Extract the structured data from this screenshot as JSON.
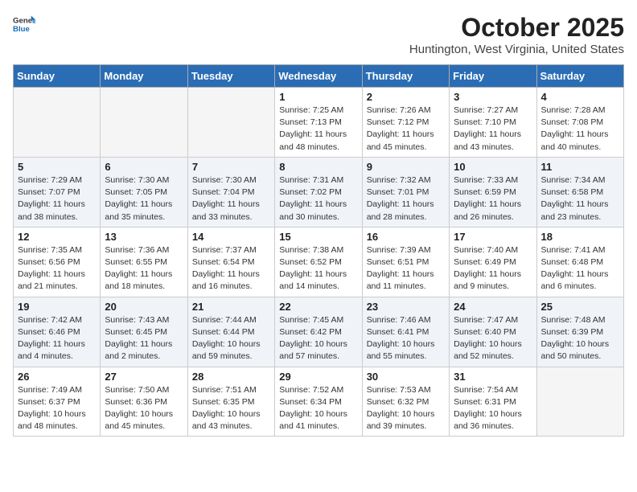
{
  "header": {
    "logo_general": "General",
    "logo_blue": "Blue",
    "month_title": "October 2025",
    "location": "Huntington, West Virginia, United States"
  },
  "weekdays": [
    "Sunday",
    "Monday",
    "Tuesday",
    "Wednesday",
    "Thursday",
    "Friday",
    "Saturday"
  ],
  "weeks": [
    [
      {
        "day": "",
        "info": ""
      },
      {
        "day": "",
        "info": ""
      },
      {
        "day": "",
        "info": ""
      },
      {
        "day": "1",
        "info": "Sunrise: 7:25 AM\nSunset: 7:13 PM\nDaylight: 11 hours\nand 48 minutes."
      },
      {
        "day": "2",
        "info": "Sunrise: 7:26 AM\nSunset: 7:12 PM\nDaylight: 11 hours\nand 45 minutes."
      },
      {
        "day": "3",
        "info": "Sunrise: 7:27 AM\nSunset: 7:10 PM\nDaylight: 11 hours\nand 43 minutes."
      },
      {
        "day": "4",
        "info": "Sunrise: 7:28 AM\nSunset: 7:08 PM\nDaylight: 11 hours\nand 40 minutes."
      }
    ],
    [
      {
        "day": "5",
        "info": "Sunrise: 7:29 AM\nSunset: 7:07 PM\nDaylight: 11 hours\nand 38 minutes."
      },
      {
        "day": "6",
        "info": "Sunrise: 7:30 AM\nSunset: 7:05 PM\nDaylight: 11 hours\nand 35 minutes."
      },
      {
        "day": "7",
        "info": "Sunrise: 7:30 AM\nSunset: 7:04 PM\nDaylight: 11 hours\nand 33 minutes."
      },
      {
        "day": "8",
        "info": "Sunrise: 7:31 AM\nSunset: 7:02 PM\nDaylight: 11 hours\nand 30 minutes."
      },
      {
        "day": "9",
        "info": "Sunrise: 7:32 AM\nSunset: 7:01 PM\nDaylight: 11 hours\nand 28 minutes."
      },
      {
        "day": "10",
        "info": "Sunrise: 7:33 AM\nSunset: 6:59 PM\nDaylight: 11 hours\nand 26 minutes."
      },
      {
        "day": "11",
        "info": "Sunrise: 7:34 AM\nSunset: 6:58 PM\nDaylight: 11 hours\nand 23 minutes."
      }
    ],
    [
      {
        "day": "12",
        "info": "Sunrise: 7:35 AM\nSunset: 6:56 PM\nDaylight: 11 hours\nand 21 minutes."
      },
      {
        "day": "13",
        "info": "Sunrise: 7:36 AM\nSunset: 6:55 PM\nDaylight: 11 hours\nand 18 minutes."
      },
      {
        "day": "14",
        "info": "Sunrise: 7:37 AM\nSunset: 6:54 PM\nDaylight: 11 hours\nand 16 minutes."
      },
      {
        "day": "15",
        "info": "Sunrise: 7:38 AM\nSunset: 6:52 PM\nDaylight: 11 hours\nand 14 minutes."
      },
      {
        "day": "16",
        "info": "Sunrise: 7:39 AM\nSunset: 6:51 PM\nDaylight: 11 hours\nand 11 minutes."
      },
      {
        "day": "17",
        "info": "Sunrise: 7:40 AM\nSunset: 6:49 PM\nDaylight: 11 hours\nand 9 minutes."
      },
      {
        "day": "18",
        "info": "Sunrise: 7:41 AM\nSunset: 6:48 PM\nDaylight: 11 hours\nand 6 minutes."
      }
    ],
    [
      {
        "day": "19",
        "info": "Sunrise: 7:42 AM\nSunset: 6:46 PM\nDaylight: 11 hours\nand 4 minutes."
      },
      {
        "day": "20",
        "info": "Sunrise: 7:43 AM\nSunset: 6:45 PM\nDaylight: 11 hours\nand 2 minutes."
      },
      {
        "day": "21",
        "info": "Sunrise: 7:44 AM\nSunset: 6:44 PM\nDaylight: 10 hours\nand 59 minutes."
      },
      {
        "day": "22",
        "info": "Sunrise: 7:45 AM\nSunset: 6:42 PM\nDaylight: 10 hours\nand 57 minutes."
      },
      {
        "day": "23",
        "info": "Sunrise: 7:46 AM\nSunset: 6:41 PM\nDaylight: 10 hours\nand 55 minutes."
      },
      {
        "day": "24",
        "info": "Sunrise: 7:47 AM\nSunset: 6:40 PM\nDaylight: 10 hours\nand 52 minutes."
      },
      {
        "day": "25",
        "info": "Sunrise: 7:48 AM\nSunset: 6:39 PM\nDaylight: 10 hours\nand 50 minutes."
      }
    ],
    [
      {
        "day": "26",
        "info": "Sunrise: 7:49 AM\nSunset: 6:37 PM\nDaylight: 10 hours\nand 48 minutes."
      },
      {
        "day": "27",
        "info": "Sunrise: 7:50 AM\nSunset: 6:36 PM\nDaylight: 10 hours\nand 45 minutes."
      },
      {
        "day": "28",
        "info": "Sunrise: 7:51 AM\nSunset: 6:35 PM\nDaylight: 10 hours\nand 43 minutes."
      },
      {
        "day": "29",
        "info": "Sunrise: 7:52 AM\nSunset: 6:34 PM\nDaylight: 10 hours\nand 41 minutes."
      },
      {
        "day": "30",
        "info": "Sunrise: 7:53 AM\nSunset: 6:32 PM\nDaylight: 10 hours\nand 39 minutes."
      },
      {
        "day": "31",
        "info": "Sunrise: 7:54 AM\nSunset: 6:31 PM\nDaylight: 10 hours\nand 36 minutes."
      },
      {
        "day": "",
        "info": ""
      }
    ]
  ]
}
